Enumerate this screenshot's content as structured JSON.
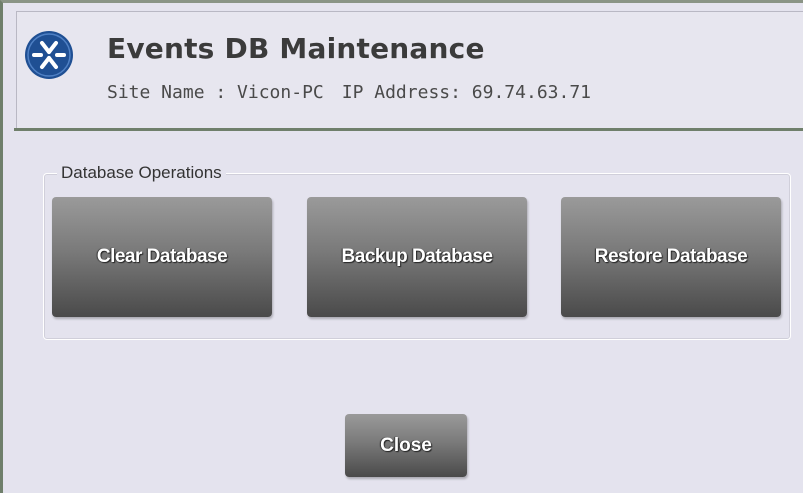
{
  "header": {
    "title": "Events DB Maintenance",
    "site_name_label": "Site Name : Vicon-PC",
    "ip_address_label": "IP Address: 69.74.63.71",
    "logo_icon": "vicon-logo-icon"
  },
  "operations": {
    "group_label": "Database Operations",
    "buttons": [
      {
        "label": "Clear Database"
      },
      {
        "label": "Backup Database"
      },
      {
        "label": "Restore Database"
      }
    ]
  },
  "footer": {
    "close_label": "Close"
  },
  "colors": {
    "background": "#e4e3ee",
    "border_accent": "#6f7f6b",
    "logo_blue": "#1f4f93",
    "button_top": "#9a9a9a",
    "button_bottom": "#4a4a4a"
  }
}
